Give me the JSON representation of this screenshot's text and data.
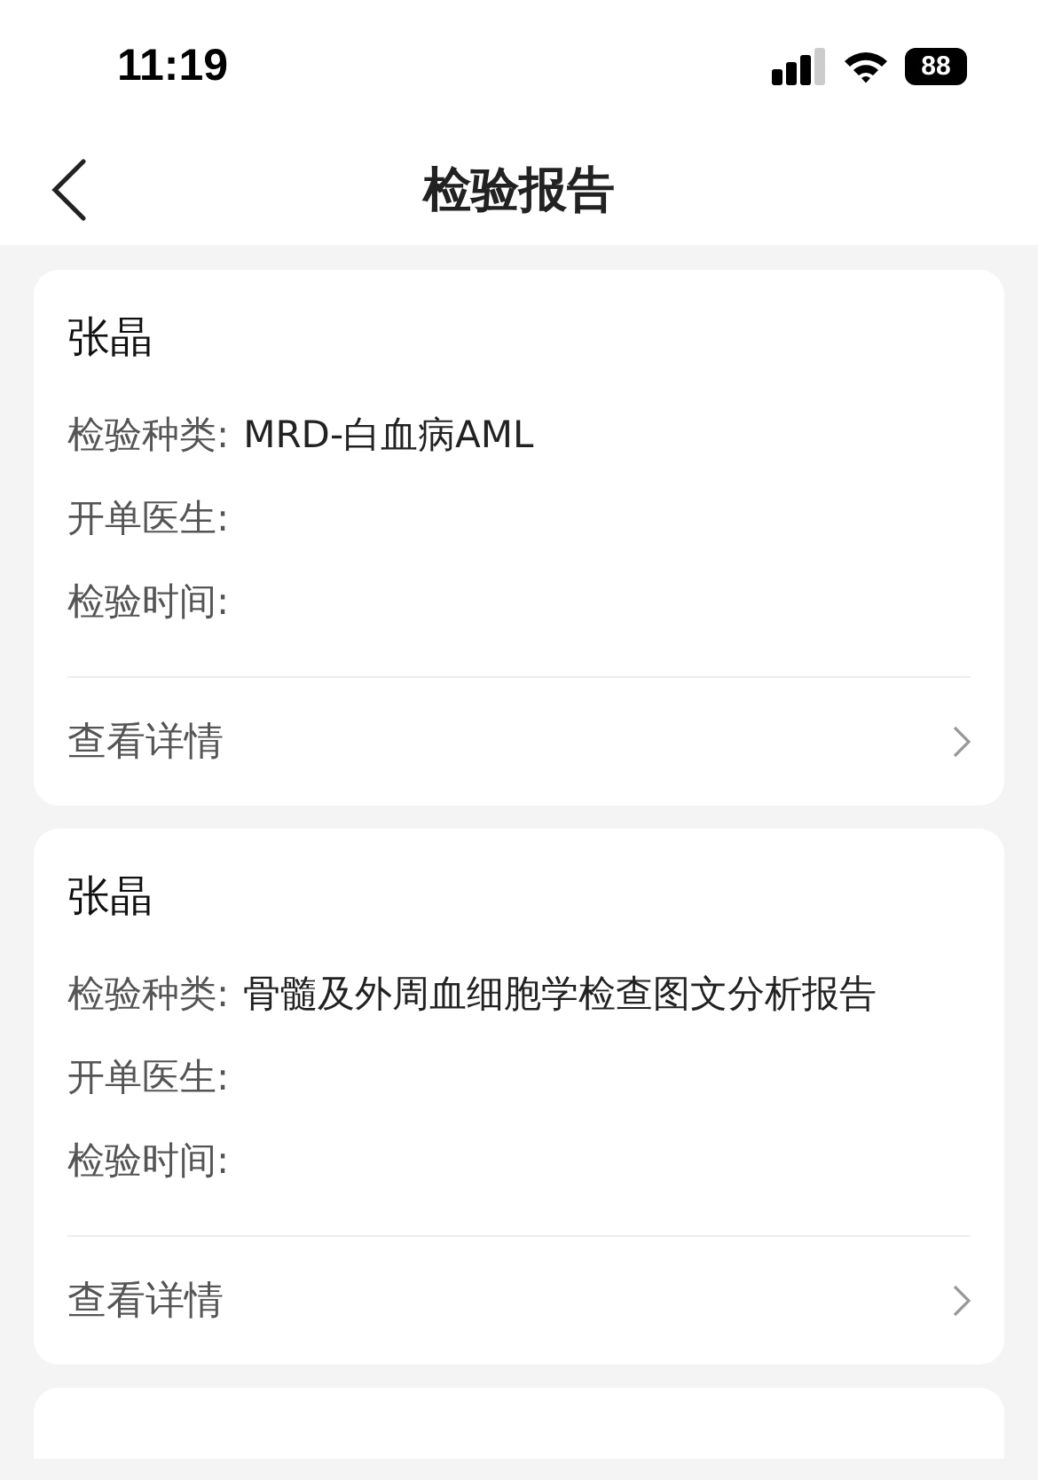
{
  "status_bar": {
    "time": "11:19",
    "battery": "88"
  },
  "nav": {
    "title": "检验报告"
  },
  "reports": [
    {
      "name": "张晶",
      "fields": [
        {
          "label": "检验种类:",
          "value": "MRD-白血病AML"
        },
        {
          "label": "开单医生:"
        },
        {
          "label": "检验时间:"
        }
      ],
      "link": "查看详情"
    },
    {
      "name": "张晶",
      "fields": [
        {
          "label": "检验种类:",
          "value": "骨髓及外周血细胞学检查图文分析报告"
        },
        {
          "label": "开单医生:"
        },
        {
          "label": "检验时间:"
        }
      ],
      "link": "查看详情"
    }
  ]
}
